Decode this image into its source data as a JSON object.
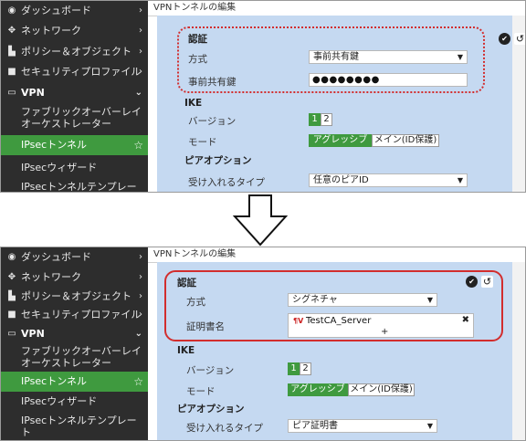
{
  "sidebar": {
    "items": [
      {
        "icon": "dashboard-icon",
        "glyph": "◉",
        "label": "ダッシュボード",
        "chevron": "›"
      },
      {
        "icon": "network-icon",
        "glyph": "✥",
        "label": "ネットワーク",
        "chevron": "›"
      },
      {
        "icon": "policy-icon",
        "glyph": "▙",
        "label": "ポリシー＆オブジェクト",
        "chevron": "›"
      },
      {
        "icon": "lock-icon",
        "glyph": "🔒",
        "label": "セキュリティプロファイル",
        "chevron": "›"
      },
      {
        "icon": "laptop-icon",
        "glyph": "▭",
        "label": "VPN",
        "chevron": "⌄"
      }
    ],
    "sub_overlay": "ファブリックオーバーレイ オーケストレーター",
    "sub_overlay_line1": "ファブリックオーバーレイ",
    "sub_overlay_line2": "オーケストレーター",
    "sub_tunnels": "IPsecトンネル",
    "sub_wizard": "IPsecウィザード",
    "sub_template": "IPsecトンネルテンプレート",
    "sub_template_line1": "IPsecトンネルテンプレー",
    "sub_template_line2": "ト",
    "star": "☆"
  },
  "page": {
    "title": "VPNトンネルの編集"
  },
  "form": {
    "auth_header": "認証",
    "method_label": "方式",
    "psk_label": "事前共有鍵",
    "psk_value": "●●●●●●●●",
    "ike_header": "IKE",
    "version_label": "バージョン",
    "version_options": [
      "1",
      "2"
    ],
    "mode_label": "モード",
    "mode_aggressive": "アグレッシブ",
    "mode_main": "メイン(ID保護)",
    "peer_header": "ピアオプション",
    "accept_type_label": "受け入れるタイプ",
    "cert_label": "証明書名",
    "cert_tag": "¶V",
    "cert_value": "TestCA_Server",
    "cert_remove": "✖",
    "cert_add": "+",
    "reset_icon": "↺",
    "check_icon": "✔"
  },
  "before": {
    "method_value": "事前共有鍵",
    "accept_type_value": "任意のピアID"
  },
  "after": {
    "method_value": "シグネチャ",
    "accept_type_value": "ピア証明書"
  },
  "colors": {
    "sidebar_bg": "#2d2d2d",
    "active_green": "#3f9a3f",
    "form_bg": "#c5d9f1",
    "highlight_red": "#d22d2d"
  }
}
